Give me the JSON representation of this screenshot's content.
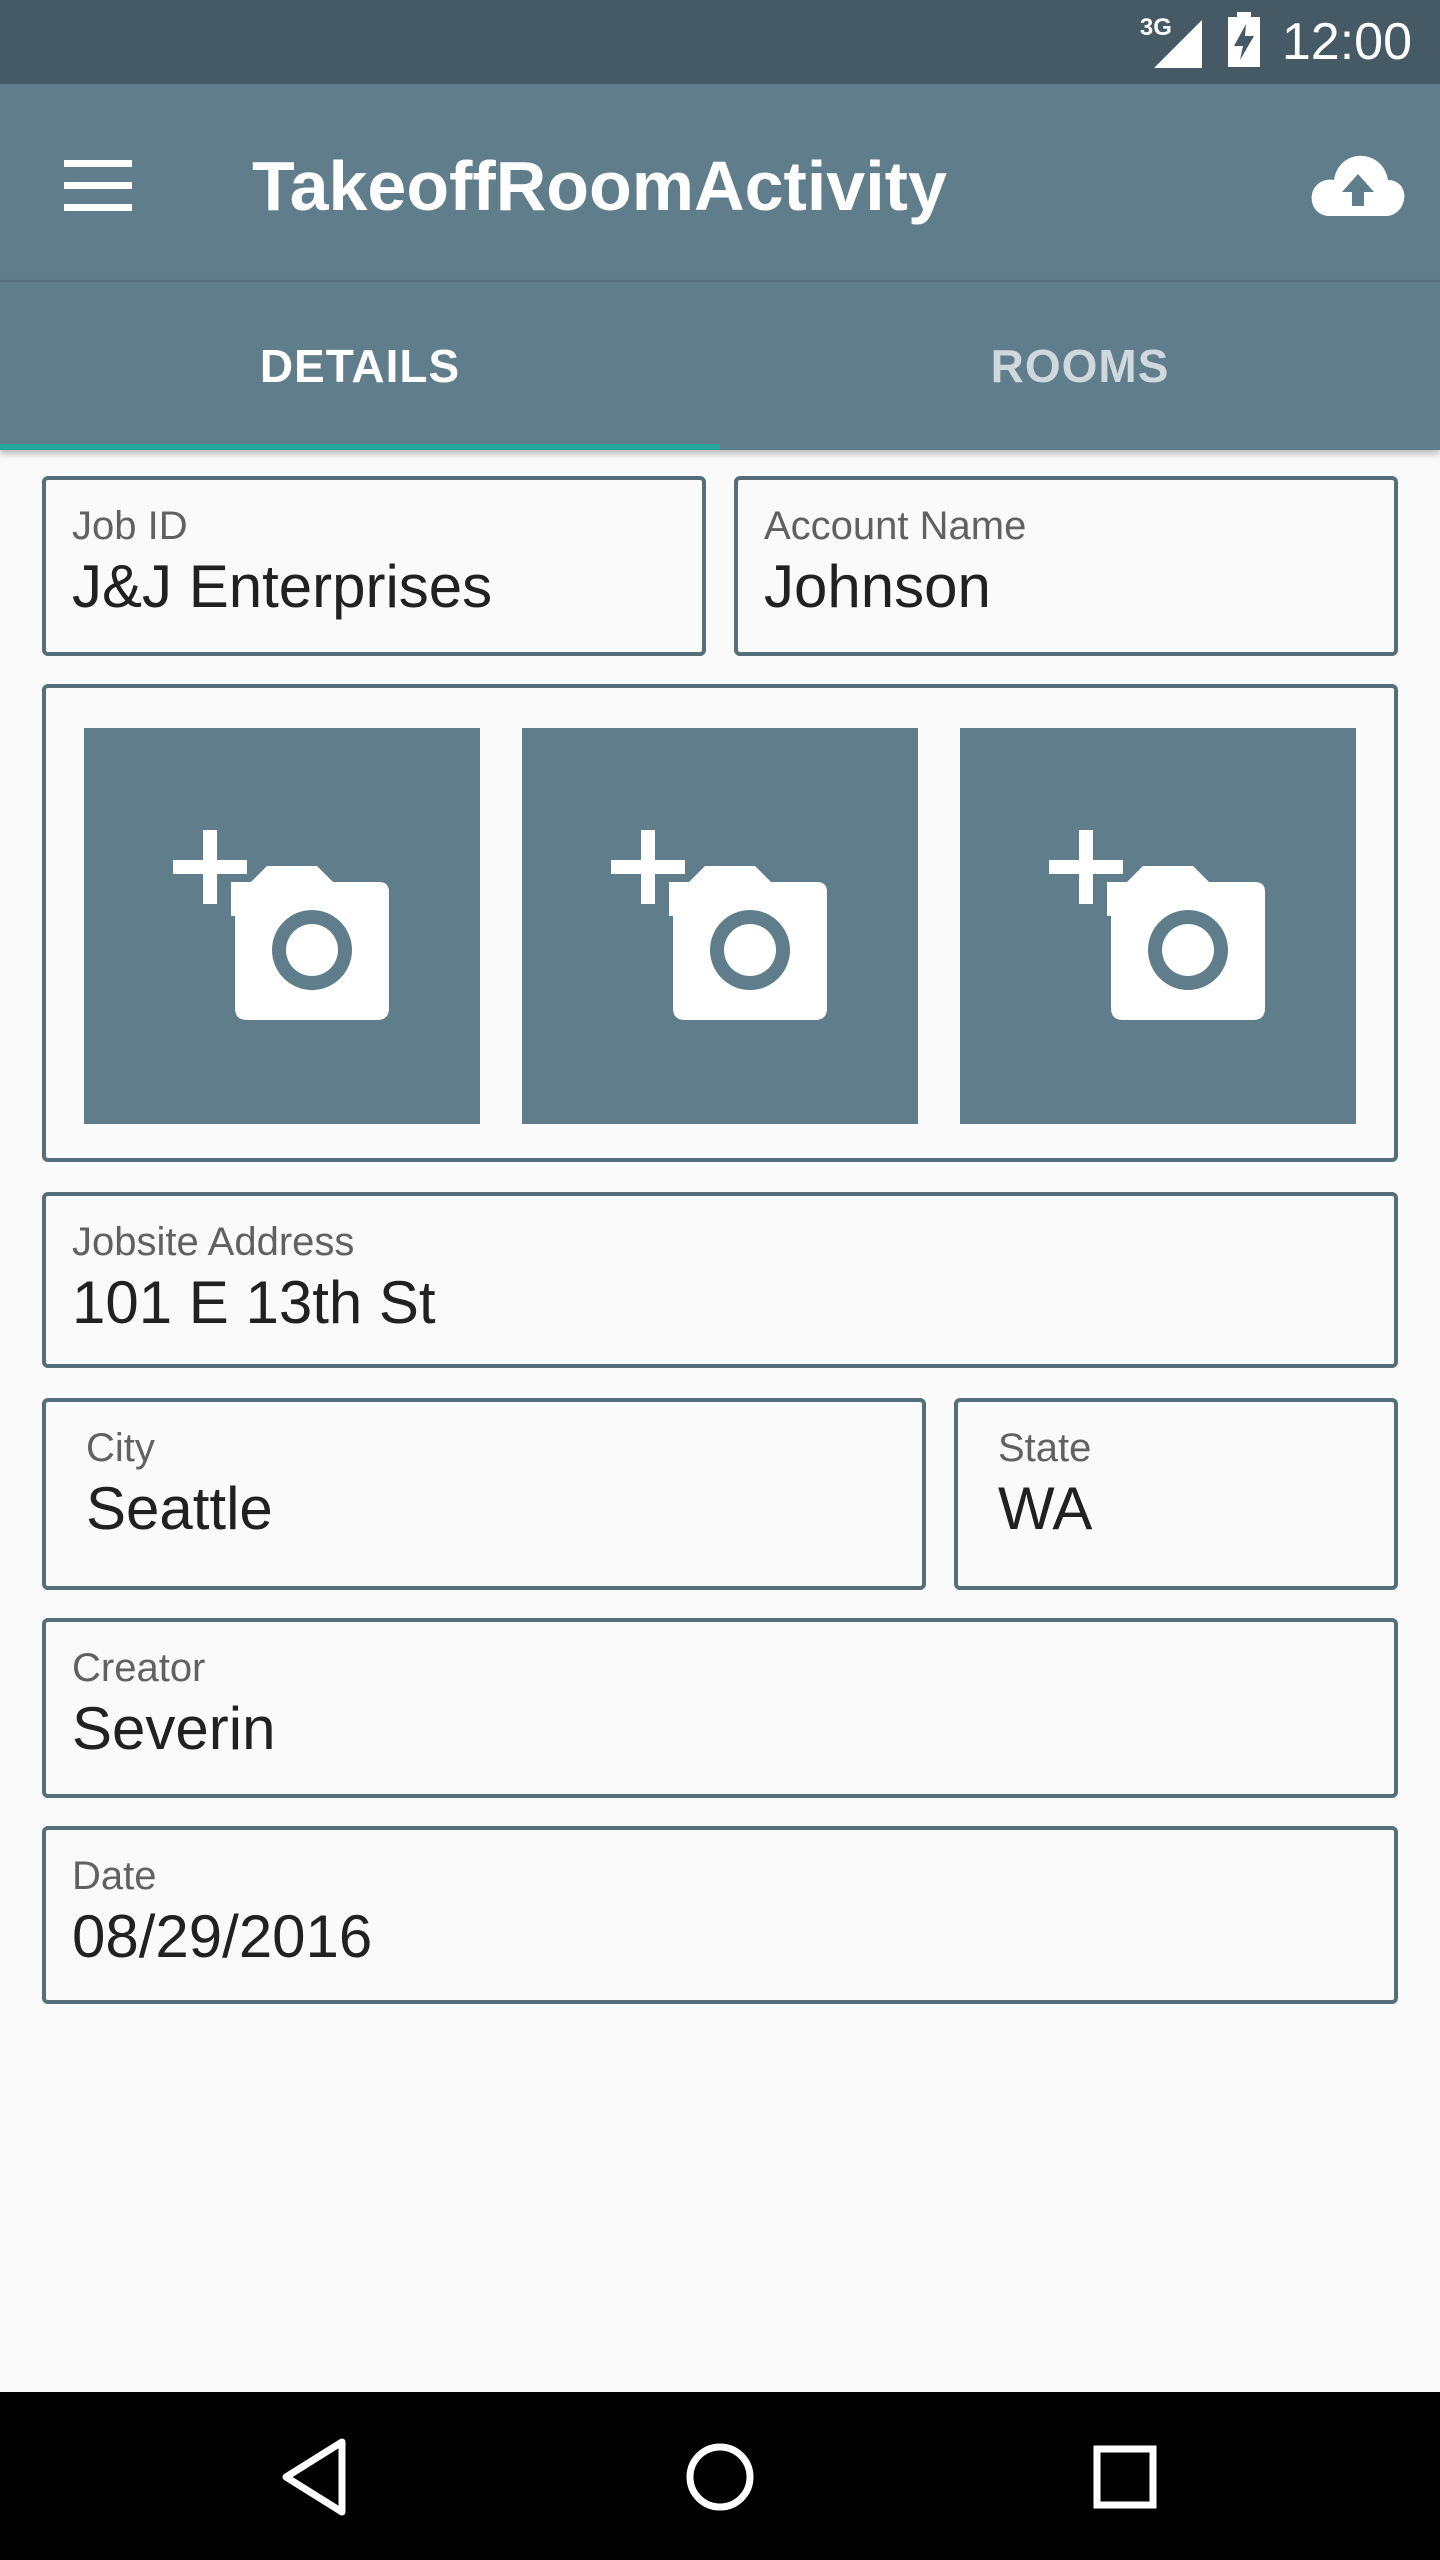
{
  "status_bar": {
    "network": "3G",
    "time": "12:00",
    "icons": [
      "signal-icon",
      "battery-charging-icon"
    ]
  },
  "app_bar": {
    "title": "TakeoffRoomActivity",
    "icons": [
      "menu-icon",
      "cloud-upload-icon"
    ]
  },
  "tabs": [
    {
      "label": "DETAILS",
      "selected": true
    },
    {
      "label": "ROOMS",
      "selected": false
    }
  ],
  "form": {
    "job_id": {
      "label": "Job ID",
      "value": "J&J Enterprises"
    },
    "account_name": {
      "label": "Account Name",
      "value": "Johnson"
    },
    "photos": {
      "count": 3,
      "icon": "add-a-photo-icon"
    },
    "jobsite_address": {
      "label": "Jobsite Address",
      "value": "101 E 13th St"
    },
    "city": {
      "label": "City",
      "value": "Seattle"
    },
    "state": {
      "label": "State",
      "value": "WA"
    },
    "creator": {
      "label": "Creator",
      "value": "Severin"
    },
    "date": {
      "label": "Date",
      "value": "08/29/2016"
    }
  },
  "nav_bar": {
    "icons": [
      "back-icon",
      "home-icon",
      "recents-icon"
    ]
  },
  "colors": {
    "status_bar": "#455a64",
    "primary": "#607d8b",
    "accent": "#26a69a",
    "field_border": "#546e7a"
  }
}
